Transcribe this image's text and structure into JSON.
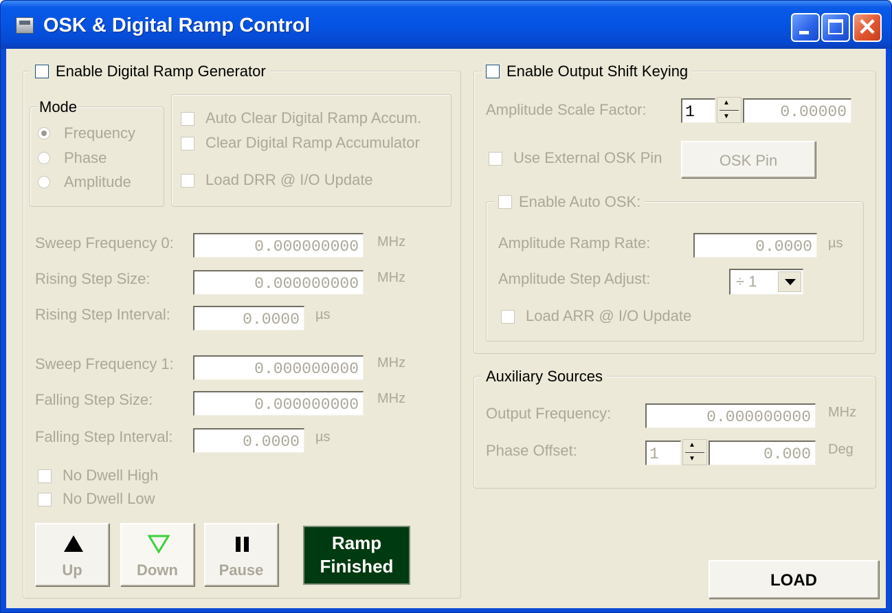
{
  "window": {
    "title": "OSK & Digital Ramp Control"
  },
  "drg": {
    "enable_label": "Enable Digital Ramp Generator",
    "mode": {
      "legend": "Mode",
      "options": [
        "Frequency",
        "Phase",
        "Amplitude"
      ],
      "selected": "Frequency"
    },
    "options": [
      "Auto Clear Digital Ramp Accum.",
      "Clear Digital Ramp Accumulator",
      "Load DRR @ I/O Update"
    ],
    "fields": [
      {
        "label": "Sweep Frequency 0:",
        "value": "0.000000000",
        "unit": "MHz"
      },
      {
        "label": "Rising Step Size:",
        "value": "0.000000000",
        "unit": "MHz"
      },
      {
        "label": "Rising Step Interval:",
        "value": "0.0000",
        "unit": "µs"
      },
      {
        "label": "Sweep Frequency 1:",
        "value": "0.000000000",
        "unit": "MHz"
      },
      {
        "label": "Falling Step Size:",
        "value": "0.000000000",
        "unit": "MHz"
      },
      {
        "label": "Falling Step Interval:",
        "value": "0.0000",
        "unit": "µs"
      }
    ],
    "dwell": [
      "No Dwell High",
      "No Dwell Low"
    ],
    "buttons": {
      "up": "Up",
      "down": "Down",
      "pause": "Pause"
    },
    "status": {
      "line1": "Ramp",
      "line2": "Finished"
    }
  },
  "osk": {
    "enable_label": "Enable Output Shift Keying",
    "asf": {
      "label": "Amplitude Scale Factor:",
      "step": "1",
      "value": "0.00000"
    },
    "ext_pin_label": "Use External OSK Pin",
    "osk_pin_button": "OSK Pin",
    "auto": {
      "enable_label": "Enable Auto OSK:",
      "ramp_rate": {
        "label": "Amplitude Ramp Rate:",
        "value": "0.0000",
        "unit": "µs"
      },
      "step_adjust": {
        "label": "Amplitude Step Adjust:",
        "value": "÷ 1"
      },
      "load_arr": "Load ARR @ I/O Update"
    }
  },
  "aux": {
    "legend": "Auxiliary Sources",
    "output_frequency": {
      "label": "Output Frequency:",
      "value": "0.000000000",
      "unit": "MHz"
    },
    "phase_offset": {
      "label": "Phase Offset:",
      "step": "1",
      "value": "0.000",
      "unit": "Deg"
    }
  },
  "load_button": "LOAD",
  "colors": {
    "title_blue": "#0554e3",
    "dialog_bg": "#ece9d8",
    "status_green": "#003a10",
    "disabled_text": "#aca899"
  }
}
